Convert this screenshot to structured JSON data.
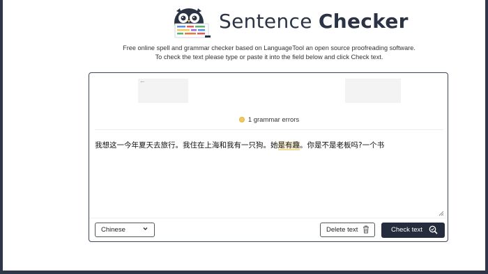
{
  "brand": {
    "light": "Sentence ",
    "bold": "Checker"
  },
  "intro": {
    "line1": "Free online spell and grammar checker based on LanguageTool an open source proofreading software.",
    "line2": "To check the text please type or paste it into the field below and click Check text."
  },
  "checker": {
    "back_arrow": "←",
    "errors_label": "1 grammar errors",
    "text_before": "我想这一今年夏天去旅行。我住在上海和我有一只狗。她",
    "text_error": "是有趣",
    "text_after": "。你是不是老板吗?一个书",
    "language": "Chinese",
    "delete_label": "Delete text",
    "check_label": "Check text"
  },
  "colors": {
    "frame": "#2e3748",
    "button_dark": "#252c3d",
    "error_highlight": "#f1c861"
  },
  "icons": [
    "owl-logo-icon",
    "chevron-down-icon",
    "trash-icon",
    "magnifier-icon",
    "resize-handle-icon",
    "back-arrow-icon"
  ]
}
